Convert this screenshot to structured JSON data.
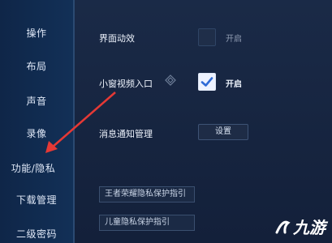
{
  "sidebar": {
    "items": [
      {
        "label": "操作"
      },
      {
        "label": "布局"
      },
      {
        "label": "声音"
      },
      {
        "label": "录像"
      },
      {
        "label": "功能/隐私"
      },
      {
        "label": "下载管理"
      },
      {
        "label": "二级密码"
      }
    ]
  },
  "settings": {
    "ui_effects": {
      "label": "界面动效",
      "option": "开启",
      "checked": false
    },
    "mini_window": {
      "label": "小窗视频入口",
      "option": "开启",
      "checked": true
    },
    "notification": {
      "label": "消息通知管理",
      "button": "设置"
    }
  },
  "privacy_links": {
    "honor_of_kings": "王者荣耀隐私保护指引",
    "children": "儿童隐私保护指引"
  },
  "watermark": {
    "text": "九游"
  }
}
